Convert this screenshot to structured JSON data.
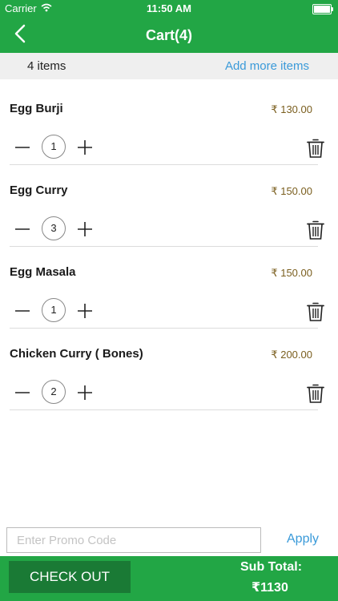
{
  "status_bar": {
    "carrier": "Carrier",
    "time": "11:50 AM"
  },
  "header": {
    "title": "Cart(4)"
  },
  "items_bar": {
    "count_text": "4  items",
    "add_more_label": "Add more items"
  },
  "cart": {
    "currency_symbol": "₹",
    "items": [
      {
        "name": "Egg Burji",
        "price": "₹ 130.00",
        "quantity": "1"
      },
      {
        "name": "Egg Curry",
        "price": "₹ 150.00",
        "quantity": "3"
      },
      {
        "name": "Egg Masala",
        "price": "₹ 150.00",
        "quantity": "1"
      },
      {
        "name": "Chicken Curry ( Bones)",
        "price": "₹ 200.00",
        "quantity": "2"
      }
    ]
  },
  "promo": {
    "placeholder": "Enter Promo Code",
    "value": "",
    "apply_label": "Apply"
  },
  "footer": {
    "checkout_label": "CHECK OUT",
    "subtotal_label": "Sub Total:",
    "subtotal_value": "₹1130"
  },
  "colors": {
    "brand_green": "#22a645",
    "checkout_dark_green": "#1a7a35",
    "link_blue": "#3a9ad9",
    "price_brown": "#7a5e1e"
  },
  "icons": [
    "wifi-icon",
    "battery-icon",
    "back-chevron-icon",
    "minus-icon",
    "plus-icon",
    "trash-icon"
  ]
}
